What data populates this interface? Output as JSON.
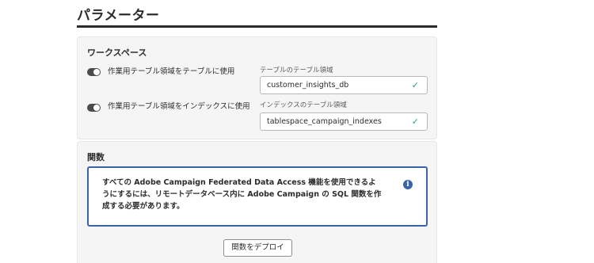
{
  "page": {
    "title": "パラメーター"
  },
  "workspace": {
    "title": "ワークスペース",
    "rows": [
      {
        "toggle_label": "作業用テーブル領域をテーブルに使用",
        "toggle_on": true,
        "field_label": "テーブルのテーブル領域",
        "field_value": "customer_insights_db",
        "valid": true
      },
      {
        "toggle_label": "作業用テーブル領域をインデックスに使用",
        "toggle_on": true,
        "field_label": "インデックスのテーブル領域",
        "field_value": "tablespace_campaign_indexes",
        "valid": true
      }
    ]
  },
  "functions": {
    "title": "関数",
    "info_text": "すべての Adobe Campaign Federated Data Access 機能を使用できるようにするには、リモートデータベース内に Adobe Campaign の SQL 関数を作成する必要があります。",
    "info_icon": "info-icon",
    "deploy_label": "関数をデプロイ"
  },
  "colors": {
    "accent": "#3b63a8",
    "valid": "#2d9d78",
    "toggle": "#4b4b4b"
  }
}
